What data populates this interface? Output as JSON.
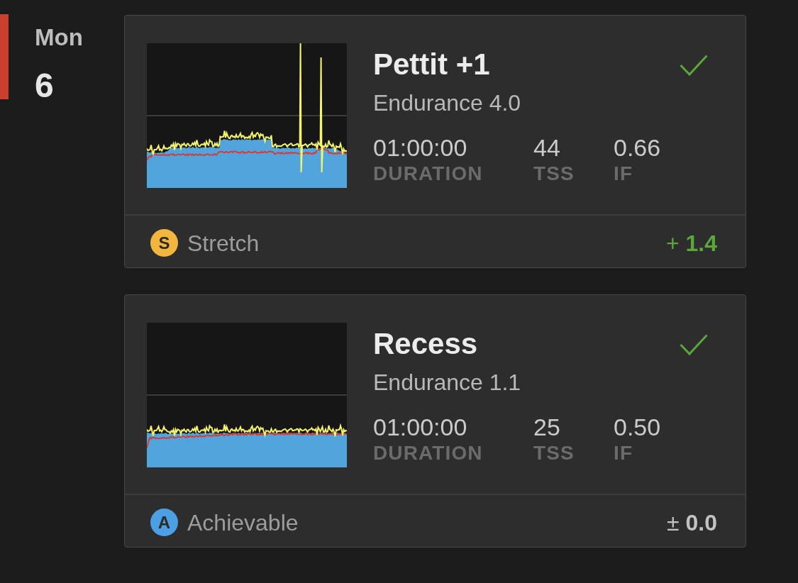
{
  "day": {
    "weekday": "Mon",
    "date": "6",
    "today": true
  },
  "workouts": [
    {
      "title": "Pettit +1",
      "subtitle": "Endurance 4.0",
      "completed": true,
      "stats": [
        {
          "value": "01:00:00",
          "label": "DURATION"
        },
        {
          "value": "44",
          "label": "TSS"
        },
        {
          "value": "0.66",
          "label": "IF"
        }
      ],
      "level": {
        "letter": "S",
        "label": "Stretch",
        "color": "#f2b53e"
      },
      "delta": {
        "text": "+ **1.4**",
        "color": "#5ba83a"
      }
    },
    {
      "title": "Recess",
      "subtitle": "Endurance 1.1",
      "completed": true,
      "stats": [
        {
          "value": "01:00:00",
          "label": "DURATION"
        },
        {
          "value": "25",
          "label": "TSS"
        },
        {
          "value": "0.50",
          "label": "IF"
        }
      ],
      "level": {
        "letter": "A",
        "label": "Achievable",
        "color": "#4c9fe2"
      },
      "delta": {
        "text": "± **0.0**",
        "color": "#c2c2c2"
      }
    }
  ]
}
